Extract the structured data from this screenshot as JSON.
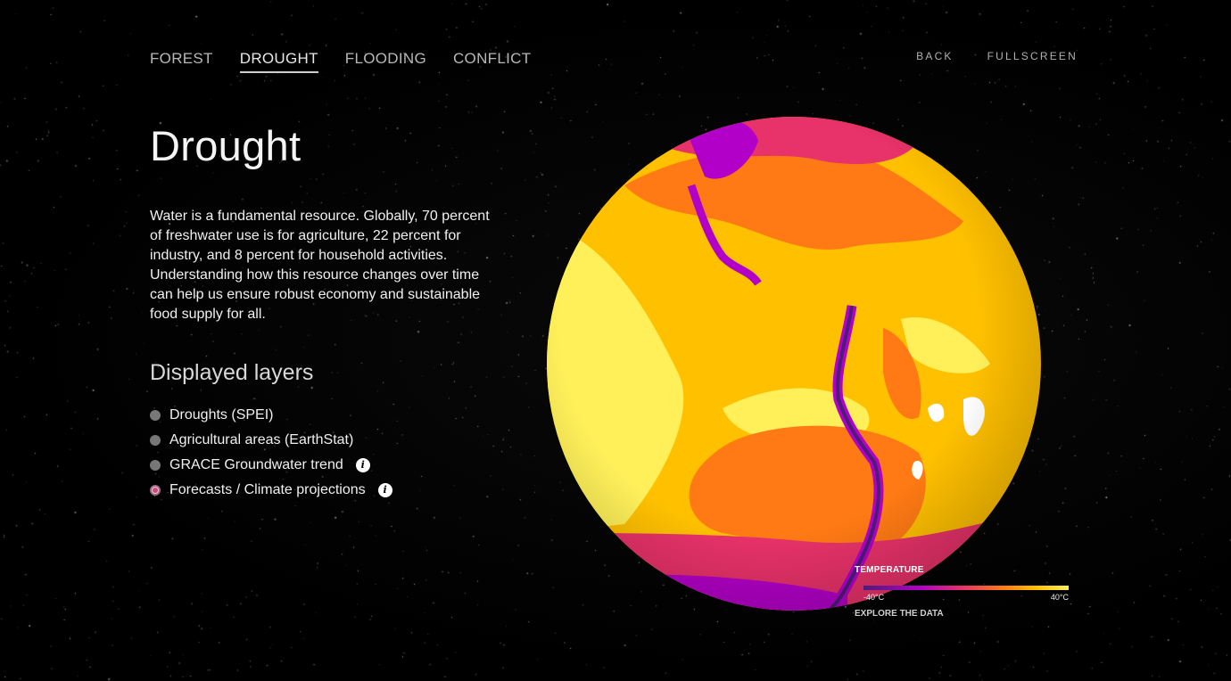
{
  "nav": {
    "tabs": [
      {
        "label": "FOREST"
      },
      {
        "label": "DROUGHT"
      },
      {
        "label": "FLOODING"
      },
      {
        "label": "CONFLICT"
      }
    ],
    "active_tab": "DROUGHT",
    "back_label": "BACK",
    "fullscreen_label": "FULLSCREEN"
  },
  "main": {
    "title": "Drought",
    "description": "Water is a fundamental resource. Globally, 70 percent of freshwater use is for agriculture, 22 percent for industry, and 8 percent for household activities. Understanding how this resource changes over time can help us ensure robust economy and sustainable food supply for all.",
    "layers_title": "Displayed layers",
    "layers": [
      {
        "label": "Droughts (SPEI)",
        "selected": false,
        "info": false
      },
      {
        "label": "Agricultural areas (EarthStat)",
        "selected": false,
        "info": false
      },
      {
        "label": "GRACE Groundwater trend",
        "selected": false,
        "info": true
      },
      {
        "label": "Forecasts / Climate projections",
        "selected": true,
        "info": true
      }
    ],
    "info_glyph": "i"
  },
  "legend": {
    "title": "TEMPERATURE",
    "min_label": "-40°C",
    "max_label": "40°C",
    "explore_label": "EXPLORE THE DATA"
  },
  "colors": {
    "cold": "#4b1c78",
    "cool": "#b300c8",
    "mild": "#e8326a",
    "warm": "#ff7a14",
    "hot": "#ffc000",
    "hottest": "#fff05a"
  }
}
